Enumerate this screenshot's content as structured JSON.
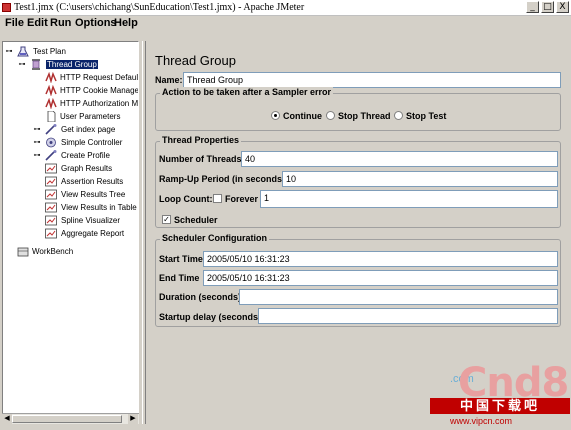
{
  "window": {
    "title": "Test1.jmx (C:\\users\\chichang\\SunEducation\\Test1.jmx) - Apache JMeter",
    "minimize": "_",
    "maximize": "□",
    "close": "X"
  },
  "menu": [
    "File",
    "Edit",
    "Run",
    "Options",
    "Help"
  ],
  "menu_mnemonics": [
    "F",
    "E",
    "R",
    "O",
    "H"
  ],
  "tree": {
    "nodes": [
      {
        "label": "Test Plan",
        "icon": "flask-icon"
      },
      {
        "label": "Thread Group",
        "icon": "spool-icon",
        "selected": true
      },
      {
        "label": "HTTP Request Defaults",
        "icon": "config-element-icon"
      },
      {
        "label": "HTTP Cookie Manager",
        "icon": "config-element-icon"
      },
      {
        "label": "HTTP Authorization Manager",
        "icon": "config-element-icon"
      },
      {
        "label": "User Parameters",
        "icon": "document-icon"
      },
      {
        "label": "Get index page",
        "icon": "sampler-icon"
      },
      {
        "label": "Simple Controller",
        "icon": "controller-icon"
      },
      {
        "label": "Create Profile",
        "icon": "sampler-icon"
      },
      {
        "label": "Graph Results",
        "icon": "listener-icon"
      },
      {
        "label": "Assertion Results",
        "icon": "listener-icon"
      },
      {
        "label": "View Results Tree",
        "icon": "listener-icon"
      },
      {
        "label": "View Results in Table",
        "icon": "listener-icon"
      },
      {
        "label": "Spline Visualizer",
        "icon": "listener-icon"
      },
      {
        "label": "Aggregate Report",
        "icon": "listener-icon"
      },
      {
        "label": "WorkBench",
        "icon": "workbench-icon"
      }
    ]
  },
  "panel": {
    "title": "Thread Group",
    "name_label": "Name:",
    "name_value": "Thread Group",
    "error_action": {
      "title": "Action to be taken after a Sampler error",
      "options": [
        "Continue",
        "Stop Thread",
        "Stop Test"
      ],
      "selected": "Continue"
    },
    "thread_properties": {
      "title": "Thread Properties",
      "threads_label": "Number of Threads:",
      "threads_value": "40",
      "rampup_label": "Ramp-Up Period (in seconds):",
      "rampup_value": "10",
      "loop_label": "Loop Count:",
      "forever_label": "Forever",
      "forever_checked": false,
      "loop_value": "1",
      "scheduler_label": "Scheduler",
      "scheduler_checked": true
    },
    "scheduler": {
      "title": "Scheduler Configuration",
      "start_label": "Start Time",
      "start_value": "2005/05/10 16:31:23",
      "end_label": "End Time",
      "end_value": "2005/05/10 16:31:23",
      "duration_label": "Duration (seconds)",
      "duration_value": "",
      "delay_label": "Startup delay (seconds)",
      "delay_value": ""
    }
  },
  "watermark": {
    "big": "Cnd8",
    "com": ".com",
    "bar": "中国下载吧",
    "url": "www.vipcn.com"
  },
  "colors": {
    "selection": "#0a246a",
    "chrome": "#d4d0c8"
  }
}
